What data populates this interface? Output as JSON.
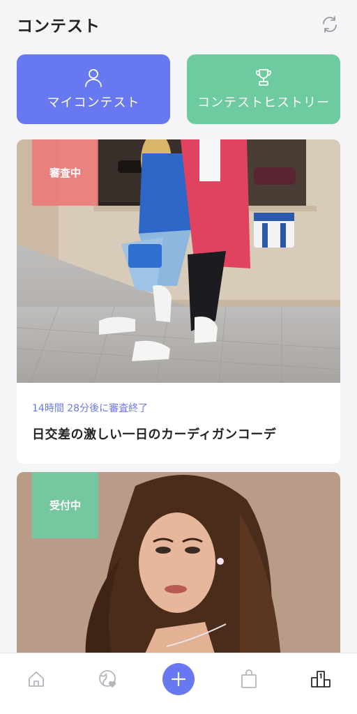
{
  "header": {
    "title": "コンテスト",
    "refresh_icon": "refresh-icon"
  },
  "quick_actions": {
    "my_contest": {
      "label": "マイコンテスト",
      "icon": "user-icon",
      "color": "#6778f0"
    },
    "contest_history": {
      "label": "コンテストヒストリー",
      "icon": "trophy-icon",
      "color": "#6ecb9f"
    }
  },
  "contests": [
    {
      "status": "審査中",
      "status_color": "#ec7878",
      "time_remaining": "14時間 28分後に審査終了",
      "title": "日交差の激しい一日のカーディガンコーデ"
    },
    {
      "status": "受付中",
      "status_color": "#6ecb9f"
    }
  ],
  "bottom_nav": {
    "items": [
      "home-icon",
      "globe-heart-icon",
      "plus-icon",
      "shopping-bag-icon",
      "ranking-podium-icon"
    ],
    "accent": "#6778f0"
  }
}
